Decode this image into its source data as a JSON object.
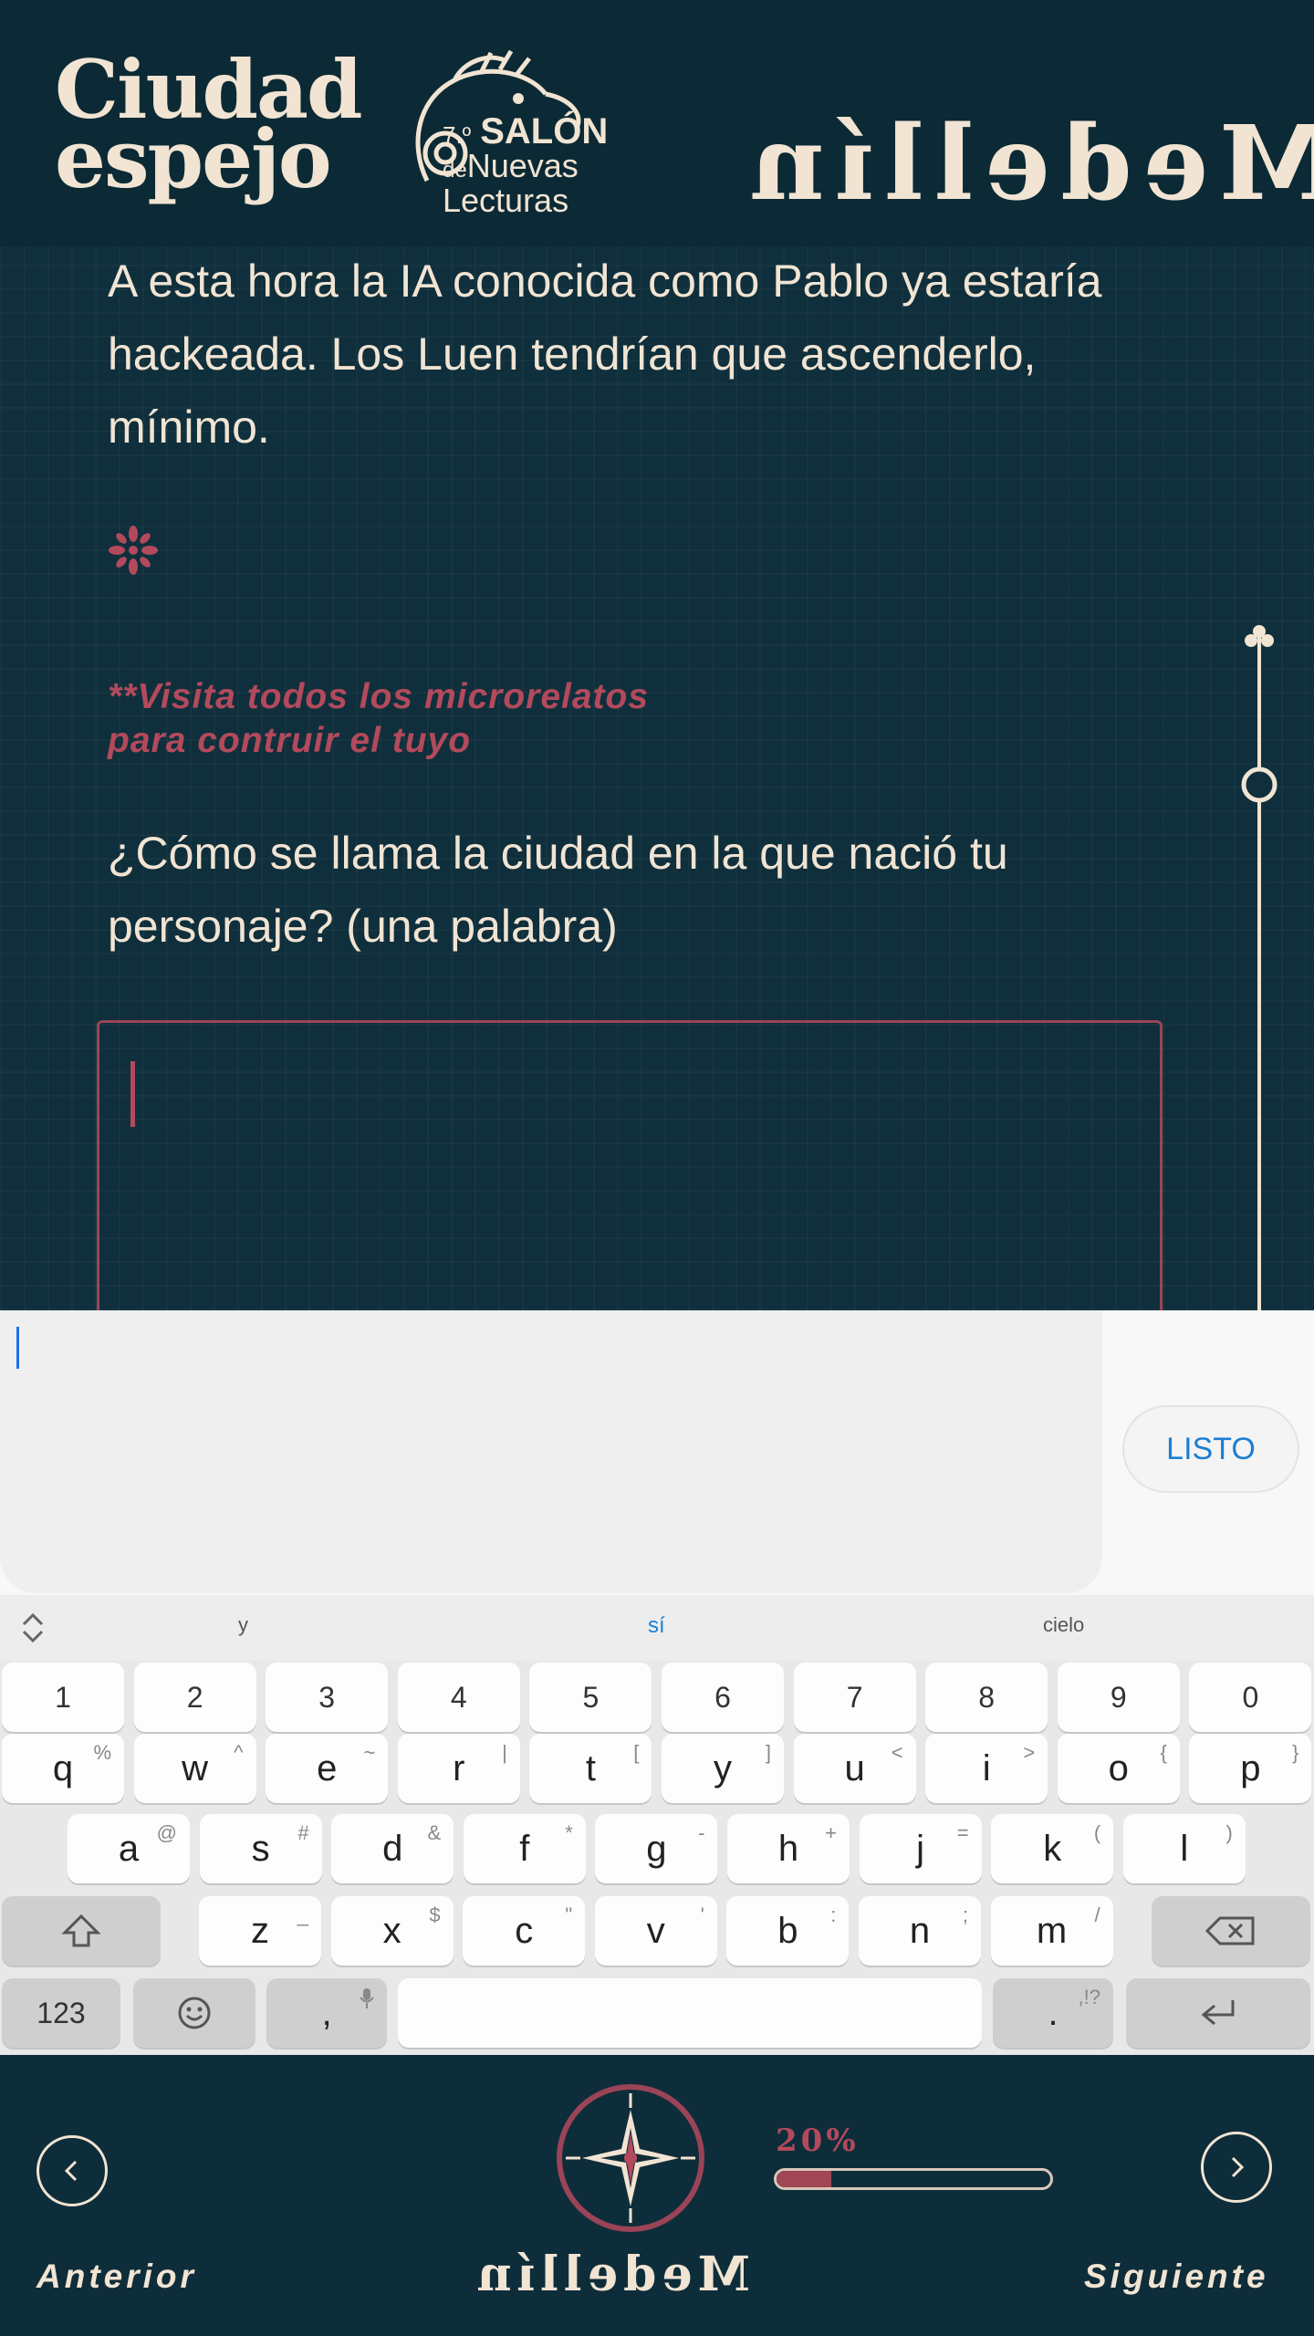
{
  "header": {
    "logo_line1": "Ciudad",
    "logo_line2": "espejo",
    "salon_number": "7.º",
    "salon_word1": "SALÓN",
    "salon_word2": "de",
    "salon_word3": "Nuevas",
    "salon_word4": "Lecturas",
    "city_mirrored": "Medellín"
  },
  "story": {
    "text": "A esta hora la IA conocida como Pablo ya estaría hackeada. Los Luen tendrían que ascenderlo, mínimo.",
    "note_line1": "**Visita todos los microrelatos",
    "note_line2": "para contruir el tuyo",
    "question": "¿Cómo se llama la ciudad en la que nació tu personaje? (una palabra)",
    "answer_value": ""
  },
  "ime": {
    "done_label": "LISTO",
    "input_value": ""
  },
  "keyboard": {
    "suggestions": [
      "y",
      "sí",
      "cielo"
    ],
    "numbers": [
      "1",
      "2",
      "3",
      "4",
      "5",
      "6",
      "7",
      "8",
      "9",
      "0"
    ],
    "row1": [
      [
        "q",
        "%"
      ],
      [
        "w",
        "^"
      ],
      [
        "e",
        "~"
      ],
      [
        "r",
        "|"
      ],
      [
        "t",
        "["
      ],
      [
        "y",
        "]"
      ],
      [
        "u",
        "<"
      ],
      [
        "i",
        ">"
      ],
      [
        "o",
        "{"
      ],
      [
        "p",
        "}"
      ]
    ],
    "row2": [
      [
        "a",
        "@"
      ],
      [
        "s",
        "#"
      ],
      [
        "d",
        "&"
      ],
      [
        "f",
        "*"
      ],
      [
        "g",
        "-"
      ],
      [
        "h",
        "+"
      ],
      [
        "j",
        "="
      ],
      [
        "k",
        "("
      ],
      [
        "l",
        ")"
      ]
    ],
    "row3": [
      [
        "z",
        "_"
      ],
      [
        "x",
        "$"
      ],
      [
        "c",
        "\""
      ],
      [
        "v",
        "'"
      ],
      [
        "b",
        ":"
      ],
      [
        "n",
        ";"
      ],
      [
        "m",
        "/"
      ]
    ],
    "mode_label": "123",
    "comma_label": ",",
    "period_label": ".",
    "period_alt": ",!?"
  },
  "footer": {
    "prev_label": "Anterior",
    "next_label": "Siguiente",
    "city_mirrored": "Medellín",
    "progress_label": "20%",
    "progress_value": 0.2
  },
  "colors": {
    "background": "#0f2f3c",
    "cream": "#f1e4d3",
    "accent": "#b34a5c",
    "ime_blue": "#1a7fd4"
  },
  "icons": [
    "asterisk-ornament-icon",
    "chameleon-logo-icon",
    "timeline-cross-icon",
    "chevron-left-icon",
    "chevron-right-icon",
    "compass-rose-icon",
    "shift-icon",
    "backspace-icon",
    "enter-icon",
    "emoji-icon",
    "mic-icon",
    "collapse-suggestions-icon"
  ]
}
